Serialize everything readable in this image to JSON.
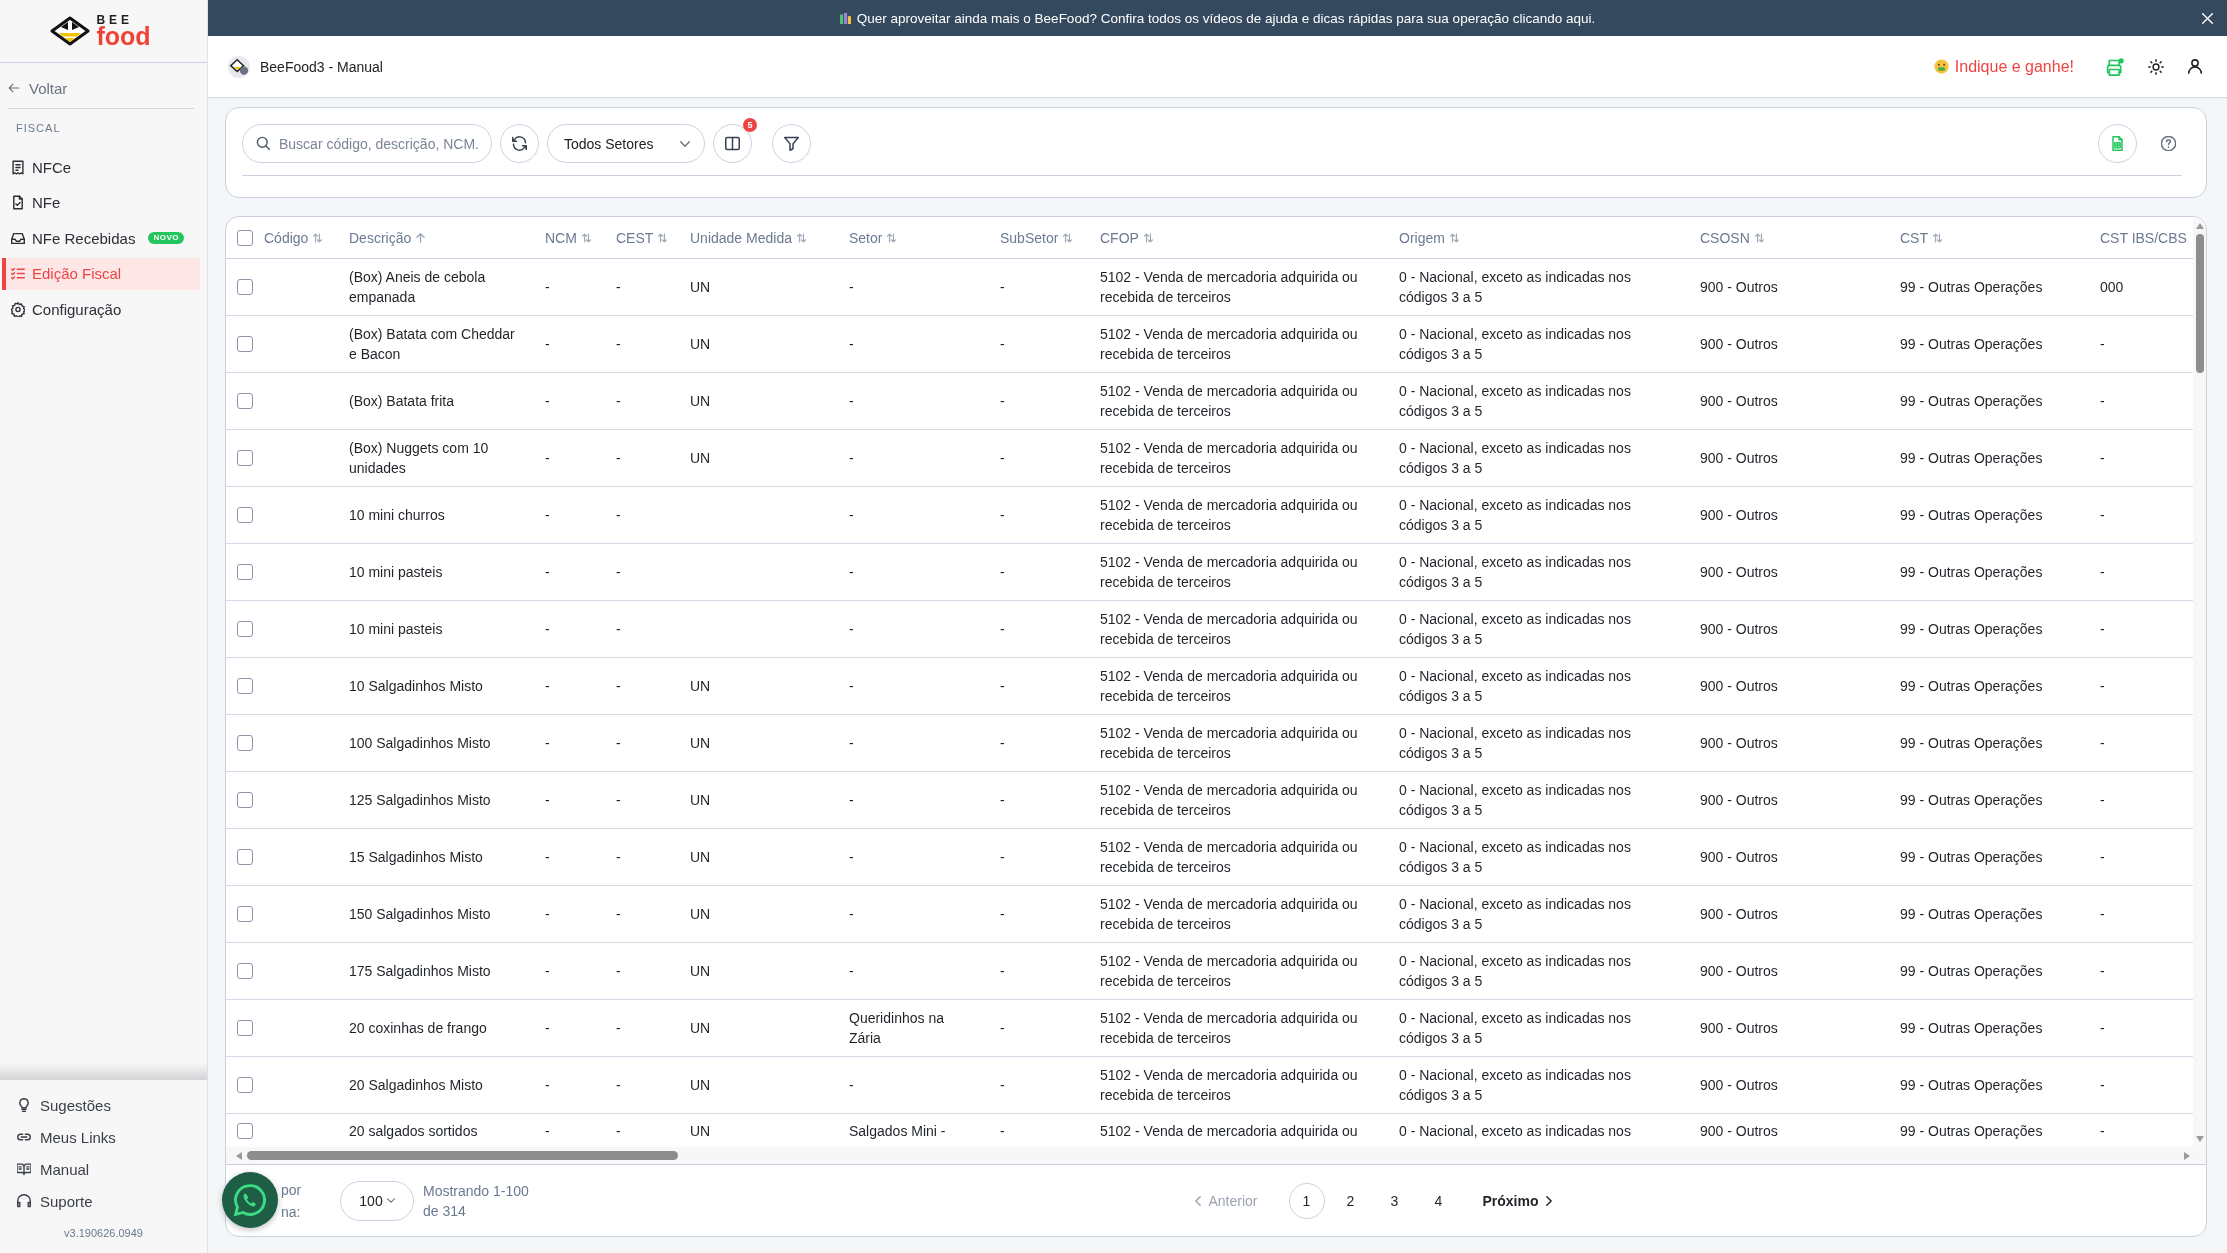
{
  "banner": {
    "text": "Quer aproveitar ainda mais o BeeFood? Confira todos os vídeos de ajuda e dicas rápidas para sua operação clicando aqui."
  },
  "sidebar": {
    "logo": {
      "top": "BEE",
      "bottom": "food"
    },
    "back": "Voltar",
    "section": "FISCAL",
    "items": [
      {
        "label": "NFCe",
        "selected": false
      },
      {
        "label": "NFe",
        "selected": false
      },
      {
        "label": "NFe Recebidas",
        "badge": "NOVO",
        "selected": false
      },
      {
        "label": "Edição Fiscal",
        "selected": true
      },
      {
        "label": "Configuração",
        "selected": false
      }
    ],
    "footer_items": [
      {
        "label": "Sugestões"
      },
      {
        "label": "Meus Links"
      },
      {
        "label": "Manual"
      },
      {
        "label": "Suporte"
      }
    ],
    "version": "v3.190626.0949"
  },
  "header": {
    "title": "BeeFood3 - Manual",
    "referral": "Indique e ganhe!",
    "printer": {
      "online": true
    }
  },
  "toolbar": {
    "search": {
      "placeholder": "Buscar código, descrição, NCM."
    },
    "sector_select": {
      "value": "Todos Setores"
    },
    "columns_button": {
      "badge": "5"
    }
  },
  "table": {
    "select_all": {
      "checked": false
    },
    "columns": [
      {
        "label": "Código",
        "sorted": false
      },
      {
        "label": "Descrição",
        "sorted": true
      },
      {
        "label": "NCM",
        "sorted": false
      },
      {
        "label": "CEST",
        "sorted": false
      },
      {
        "label": "Unidade Medida",
        "sorted": false
      },
      {
        "label": "Setor",
        "sorted": false
      },
      {
        "label": "SubSetor",
        "sorted": false
      },
      {
        "label": "CFOP",
        "sorted": false
      },
      {
        "label": "Origem",
        "sorted": false
      },
      {
        "label": "CSOSN",
        "sorted": false
      },
      {
        "label": "CST",
        "sorted": false
      },
      {
        "label": "CST IBS/CBS"
      }
    ],
    "rows": [
      {
        "checked": false,
        "descricao": "(Box) Aneis de cebola empanada",
        "ncm": "-",
        "cest": "-",
        "unidade": "UN",
        "setor": "-",
        "subsetor": "-",
        "cfop": "5102 - Venda de mercadoria adquirida ou recebida de terceiros",
        "origem": "0 - Nacional, exceto as indicadas nos códigos 3 a 5",
        "csosn": "900 - Outros",
        "cst": "99 - Outras Operações",
        "cst_ibs_cbs": "000"
      },
      {
        "checked": false,
        "descricao": "(Box) Batata com Cheddar e Bacon",
        "ncm": "-",
        "cest": "-",
        "unidade": "UN",
        "setor": "-",
        "subsetor": "-",
        "cfop": "5102 - Venda de mercadoria adquirida ou recebida de terceiros",
        "origem": "0 - Nacional, exceto as indicadas nos códigos 3 a 5",
        "csosn": "900 - Outros",
        "cst": "99 - Outras Operações",
        "cst_ibs_cbs": "-"
      },
      {
        "checked": false,
        "descricao": "(Box) Batata frita",
        "ncm": "-",
        "cest": "-",
        "unidade": "UN",
        "setor": "-",
        "subsetor": "-",
        "cfop": "5102 - Venda de mercadoria adquirida ou recebida de terceiros",
        "origem": "0 - Nacional, exceto as indicadas nos códigos 3 a 5",
        "csosn": "900 - Outros",
        "cst": "99 - Outras Operações",
        "cst_ibs_cbs": "-"
      },
      {
        "checked": false,
        "descricao": "(Box) Nuggets com 10 unidades",
        "ncm": "-",
        "cest": "-",
        "unidade": "UN",
        "setor": "-",
        "subsetor": "-",
        "cfop": "5102 - Venda de mercadoria adquirida ou recebida de terceiros",
        "origem": "0 - Nacional, exceto as indicadas nos códigos 3 a 5",
        "csosn": "900 - Outros",
        "cst": "99 - Outras Operações",
        "cst_ibs_cbs": "-"
      },
      {
        "checked": false,
        "descricao": "10 mini churros",
        "ncm": "-",
        "cest": "-",
        "setor": "-",
        "subsetor": "-",
        "cfop": "5102 - Venda de mercadoria adquirida ou recebida de terceiros",
        "origem": "0 - Nacional, exceto as indicadas nos códigos 3 a 5",
        "csosn": "900 - Outros",
        "cst": "99 - Outras Operações",
        "cst_ibs_cbs": "-"
      },
      {
        "checked": false,
        "descricao": "10 mini pasteis",
        "ncm": "-",
        "cest": "-",
        "setor": "-",
        "subsetor": "-",
        "cfop": "5102 - Venda de mercadoria adquirida ou recebida de terceiros",
        "origem": "0 - Nacional, exceto as indicadas nos códigos 3 a 5",
        "csosn": "900 - Outros",
        "cst": "99 - Outras Operações",
        "cst_ibs_cbs": "-"
      },
      {
        "checked": false,
        "descricao": "10 mini pasteis",
        "ncm": "-",
        "cest": "-",
        "setor": "-",
        "subsetor": "-",
        "cfop": "5102 - Venda de mercadoria adquirida ou recebida de terceiros",
        "origem": "0 - Nacional, exceto as indicadas nos códigos 3 a 5",
        "csosn": "900 - Outros",
        "cst": "99 - Outras Operações",
        "cst_ibs_cbs": "-"
      },
      {
        "checked": false,
        "descricao": "10 Salgadinhos Misto",
        "ncm": "-",
        "cest": "-",
        "unidade": "UN",
        "setor": "-",
        "subsetor": "-",
        "cfop": "5102 - Venda de mercadoria adquirida ou recebida de terceiros",
        "origem": "0 - Nacional, exceto as indicadas nos códigos 3 a 5",
        "csosn": "900 - Outros",
        "cst": "99 - Outras Operações",
        "cst_ibs_cbs": "-"
      },
      {
        "checked": false,
        "descricao": "100 Salgadinhos Misto",
        "ncm": "-",
        "cest": "-",
        "unidade": "UN",
        "setor": "-",
        "subsetor": "-",
        "cfop": "5102 - Venda de mercadoria adquirida ou recebida de terceiros",
        "origem": "0 - Nacional, exceto as indicadas nos códigos 3 a 5",
        "csosn": "900 - Outros",
        "cst": "99 - Outras Operações",
        "cst_ibs_cbs": "-"
      },
      {
        "checked": false,
        "descricao": "125 Salgadinhos Misto",
        "ncm": "-",
        "cest": "-",
        "unidade": "UN",
        "setor": "-",
        "subsetor": "-",
        "cfop": "5102 - Venda de mercadoria adquirida ou recebida de terceiros",
        "origem": "0 - Nacional, exceto as indicadas nos códigos 3 a 5",
        "csosn": "900 - Outros",
        "cst": "99 - Outras Operações",
        "cst_ibs_cbs": "-"
      },
      {
        "checked": false,
        "descricao": "15 Salgadinhos Misto",
        "ncm": "-",
        "cest": "-",
        "unidade": "UN",
        "setor": "-",
        "subsetor": "-",
        "cfop": "5102 - Venda de mercadoria adquirida ou recebida de terceiros",
        "origem": "0 - Nacional, exceto as indicadas nos códigos 3 a 5",
        "csosn": "900 - Outros",
        "cst": "99 - Outras Operações",
        "cst_ibs_cbs": "-"
      },
      {
        "checked": false,
        "descricao": "150 Salgadinhos Misto",
        "ncm": "-",
        "cest": "-",
        "unidade": "UN",
        "setor": "-",
        "subsetor": "-",
        "cfop": "5102 - Venda de mercadoria adquirida ou recebida de terceiros",
        "origem": "0 - Nacional, exceto as indicadas nos códigos 3 a 5",
        "csosn": "900 - Outros",
        "cst": "99 - Outras Operações",
        "cst_ibs_cbs": "-"
      },
      {
        "checked": false,
        "descricao": "175 Salgadinhos Misto",
        "ncm": "-",
        "cest": "-",
        "unidade": "UN",
        "setor": "-",
        "subsetor": "-",
        "cfop": "5102 - Venda de mercadoria adquirida ou recebida de terceiros",
        "origem": "0 - Nacional, exceto as indicadas nos códigos 3 a 5",
        "csosn": "900 - Outros",
        "cst": "99 - Outras Operações",
        "cst_ibs_cbs": "-"
      },
      {
        "checked": false,
        "descricao": "20 coxinhas de frango",
        "ncm": "-",
        "cest": "-",
        "unidade": "UN",
        "setor": "Queridinhos na Zária",
        "subsetor": "-",
        "cfop": "5102 - Venda de mercadoria adquirida ou recebida de terceiros",
        "origem": "0 - Nacional, exceto as indicadas nos códigos 3 a 5",
        "csosn": "900 - Outros",
        "cst": "99 - Outras Operações",
        "cst_ibs_cbs": "-"
      },
      {
        "checked": false,
        "descricao": "20 Salgadinhos Misto",
        "ncm": "-",
        "cest": "-",
        "unidade": "UN",
        "setor": "-",
        "subsetor": "-",
        "cfop": "5102 - Venda de mercadoria adquirida ou recebida de terceiros",
        "origem": "0 - Nacional, exceto as indicadas nos códigos 3 a 5",
        "csosn": "900 - Outros",
        "cst": "99 - Outras Operações",
        "cst_ibs_cbs": "-"
      },
      {
        "checked": false,
        "descricao": "20 salgados sortidos",
        "ncm": "-",
        "cest": "-",
        "unidade": "UN",
        "setor": "Salgados Mini -",
        "subsetor": "-",
        "cfop": "5102 - Venda de mercadoria adquirida ou",
        "origem": "0 - Nacional, exceto as indicadas nos",
        "csosn": "900 - Outros",
        "cst": "99 - Outras Operações",
        "cst_ibs_cbs": "-"
      }
    ]
  },
  "footer": {
    "per_page_label": "por na:",
    "per_page": "100",
    "showing": "Mostrando 1-100 de 314",
    "prev": {
      "label": "Anterior",
      "disabled": true
    },
    "pages": [
      {
        "label": "1",
        "selected": true
      },
      {
        "label": "2",
        "selected": false
      },
      {
        "label": "3",
        "selected": false
      },
      {
        "label": "4",
        "selected": false
      }
    ],
    "next": {
      "label": "Próximo",
      "disabled": false
    }
  }
}
